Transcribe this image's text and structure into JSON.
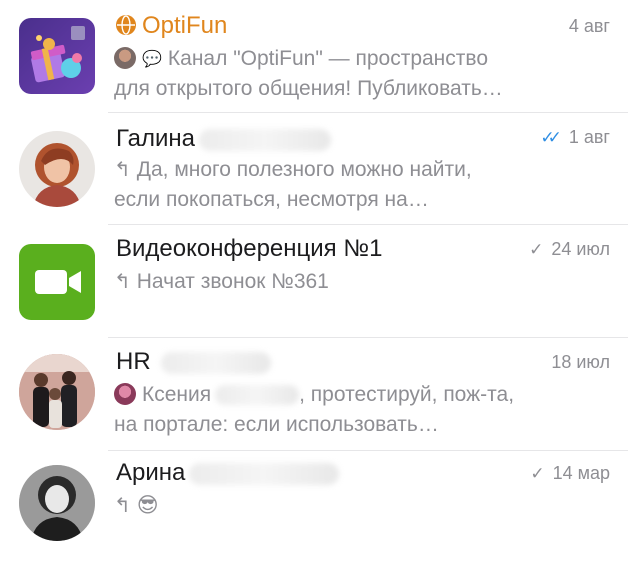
{
  "chats": [
    {
      "name": "OptiFun",
      "globe_icon": "globe-icon",
      "date": "4 авг",
      "preview_line1": "Канал \"OptiFun\" — пространство",
      "preview_line2": "для открытого общения! Публиковать…"
    },
    {
      "name": "Галина",
      "date": "1 авг",
      "status": "read",
      "preview_line1": "Да, много полезного можно найти,",
      "preview_line2": "если покопаться, несмотря на…"
    },
    {
      "name": "Видеоконференция №1",
      "date": "24 июл",
      "status": "sent",
      "preview_line1": "Начат звонок №361"
    },
    {
      "name": "HR",
      "date": "18 июл",
      "preview_sender": "Ксения",
      "preview_line1_rest": ", протестируй, пож-та,",
      "preview_line2": "на портале: если использовать…"
    },
    {
      "name": "Арина",
      "date": "14 мар",
      "status": "sent",
      "preview_emoji": "😎"
    }
  ],
  "icons": {
    "reply": "reply-arrow-icon",
    "check_single": "check-icon",
    "check_double": "double-check-icon",
    "bubble": "speech-bubble-icon",
    "video": "video-camera-icon"
  },
  "colors": {
    "accent": "#e0861d",
    "read_check": "#2f8ee3",
    "meta": "#8e8e93",
    "video_green": "#5aaf1e"
  }
}
